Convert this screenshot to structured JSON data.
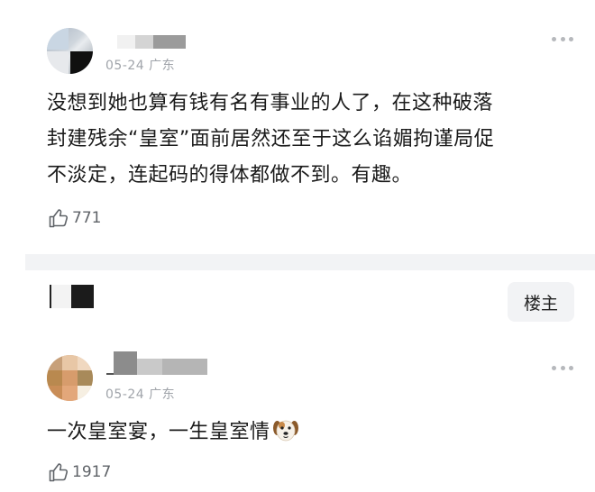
{
  "comments": [
    {
      "date": "05-24",
      "location": "广东",
      "text_lines": [
        "没想到她也算有钱有名有事业的人了，在这种破落",
        "封建残余“皇室”面前居然还至于这么谄媚拘谨局促",
        "不淡定，连起码的得体都做不到。有趣。"
      ],
      "likes": "771"
    },
    {
      "date": "05-24",
      "location": "广东",
      "text": "一次皇室宴，一生皇室情",
      "emoji": "dog-face",
      "likes": "1917"
    }
  ],
  "reply_header": {
    "op_badge": "楼主"
  },
  "icons": {
    "more": "more-dots-icon",
    "like": "thumbs-up-icon"
  },
  "colors": {
    "meta": "#a0a4aa",
    "divider": "#f2f3f5",
    "badge_bg": "#f2f3f5"
  }
}
